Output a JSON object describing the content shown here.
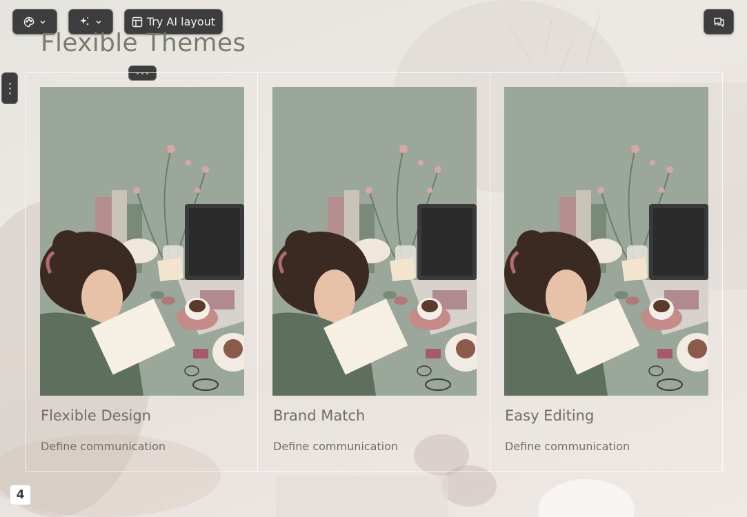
{
  "toolbar": {
    "theme_icon": "palette-icon",
    "ai_icon": "sparkles-icon",
    "layout_icon": "layout-icon",
    "ai_layout_label": "Try AI layout",
    "comments_icon": "comments-icon"
  },
  "slide": {
    "title": "Flexible Themes",
    "cards": [
      {
        "title": "Flexible Design",
        "description": "Define communication",
        "image": "woman-desk-illustration"
      },
      {
        "title": "Brand Match",
        "description": "Define communication",
        "image": "woman-desk-illustration"
      },
      {
        "title": "Easy Editing",
        "description": "Define communication",
        "image": "woman-desk-illustration"
      }
    ],
    "page_number": "4"
  },
  "colors": {
    "toolbar_bg": "#3d3d3d",
    "text": "#6e6e66",
    "image_bg": "#9aa79a"
  }
}
